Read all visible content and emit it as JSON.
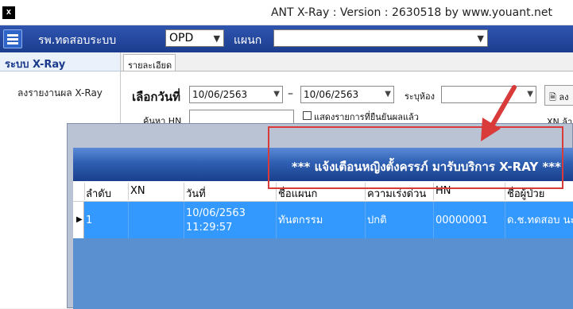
{
  "window": {
    "icon": "X",
    "title": "ANT X-Ray : Version : 2630518 by www.youant.net"
  },
  "toolbar": {
    "hospital": "รพ.ทดสอบระบบ",
    "type_select": "OPD",
    "dept_label": "แผนก",
    "dept_select": ""
  },
  "sidebar": {
    "heading": "ระบบ X-Ray",
    "items": [
      {
        "label": "ลงรายงานผล X-Ray"
      }
    ]
  },
  "tabs": [
    {
      "label": "รายละเอียด"
    }
  ],
  "filters": {
    "date_label": "เลือกวันที่",
    "date_from": "10/06/2563",
    "date_to": "10/06/2563",
    "dash": "–",
    "room_label": "ระบุห้อง",
    "room_value": "",
    "doc_button": "ลง",
    "hn_label": "ค้นหา HN",
    "hn_value": "",
    "checkbox_label": "แสดงรายการที่ยืนยันผลแล้ว",
    "xn_label": "XN ล้า"
  },
  "dialog": {
    "message": "*** แจ้งเตือนหญิงตั้งครรภ์ มารับบริการ X-RAY ***",
    "columns": [
      "ลำดับ",
      "XN",
      "วันที่",
      "ชื่อแผนก",
      "ความเร่งด่วน",
      "HN",
      "ชื่อผู้ป่วย"
    ],
    "rows": [
      {
        "seq": "1",
        "xn": "",
        "date": "10/06/2563",
        "time": "11:29:57",
        "dept": "ทันตกรรม",
        "urgency": "ปกติ",
        "hn": "00000001",
        "patient": "ด.ช.ทดสอบ นะ"
      }
    ]
  },
  "colors": {
    "toolbar": "#1c3d8f",
    "selection": "#3399ff",
    "highlight": "#d93b3b"
  },
  "icons": [
    "app-icon",
    "menu-icon",
    "chevron-down-icon",
    "document-icon",
    "row-pointer-icon",
    "annotation-arrow"
  ]
}
